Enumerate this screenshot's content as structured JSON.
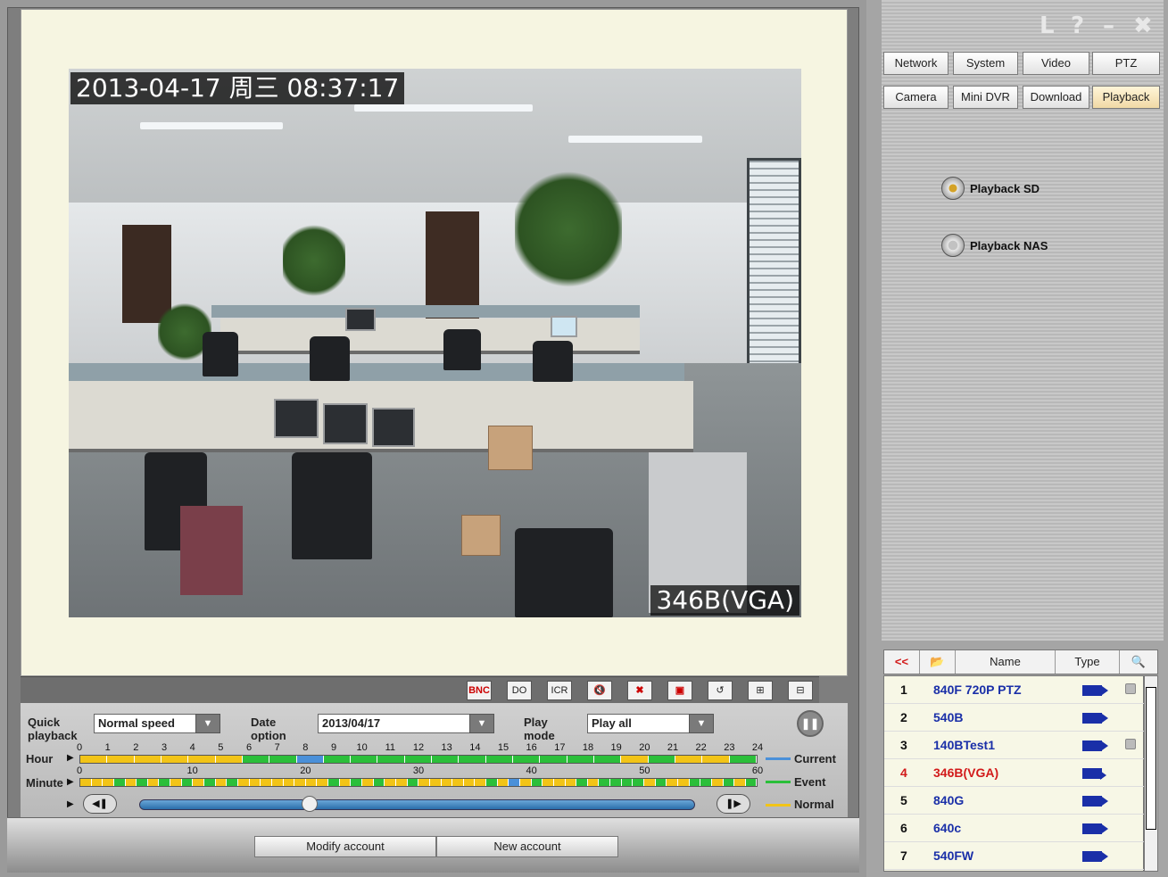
{
  "video": {
    "timestamp": "2013-04-17 周三 08:37:17",
    "camera_label": "346B(VGA)"
  },
  "toolbar": {
    "bnc": "BNC",
    "do": "DO",
    "icr": "ICR"
  },
  "controls": {
    "quick_playback_label": "Quick playback",
    "quick_playback_value": "Normal speed",
    "date_option_label": "Date option",
    "date_value": "2013/04/17",
    "play_mode_label": "Play mode",
    "play_mode_value": "Play all",
    "hour_label": "Hour",
    "minute_label": "Minute",
    "hour_ticks": [
      "0",
      "1",
      "2",
      "3",
      "4",
      "5",
      "6",
      "7",
      "8",
      "9",
      "10",
      "11",
      "12",
      "13",
      "14",
      "15",
      "16",
      "17",
      "18",
      "19",
      "20",
      "21",
      "22",
      "23",
      "24"
    ],
    "minute_ticks": [
      "0",
      "10",
      "20",
      "30",
      "40",
      "50",
      "60"
    ],
    "legend": {
      "current": "Current",
      "event": "Event",
      "normal": "Normal"
    },
    "colors": {
      "current": "#4a90d9",
      "event": "#2bbf3a",
      "normal": "#f2c417"
    }
  },
  "bottom": {
    "modify_account": "Modify account",
    "new_account": "New account"
  },
  "right": {
    "top_tabs": [
      "Network",
      "System",
      "Video",
      "PTZ"
    ],
    "sub_tabs": [
      "Camera",
      "Mini DVR",
      "Download",
      "Playback"
    ],
    "active_sub_tab": "Playback",
    "playback_sd": "Playback SD",
    "playback_nas": "Playback NAS",
    "list_header": {
      "back": "<<",
      "name": "Name",
      "type": "Type"
    },
    "cameras": [
      {
        "no": "1",
        "name": "840F 720P PTZ",
        "locked": true,
        "active": false
      },
      {
        "no": "2",
        "name": "540B",
        "locked": false,
        "active": false
      },
      {
        "no": "3",
        "name": "140BTest1",
        "locked": true,
        "active": false
      },
      {
        "no": "4",
        "name": "346B(VGA)",
        "locked": false,
        "active": true
      },
      {
        "no": "5",
        "name": "840G",
        "locked": false,
        "active": false
      },
      {
        "no": "6",
        "name": "640c",
        "locked": false,
        "active": false
      },
      {
        "no": "7",
        "name": "540FW",
        "locked": false,
        "active": false
      }
    ]
  }
}
